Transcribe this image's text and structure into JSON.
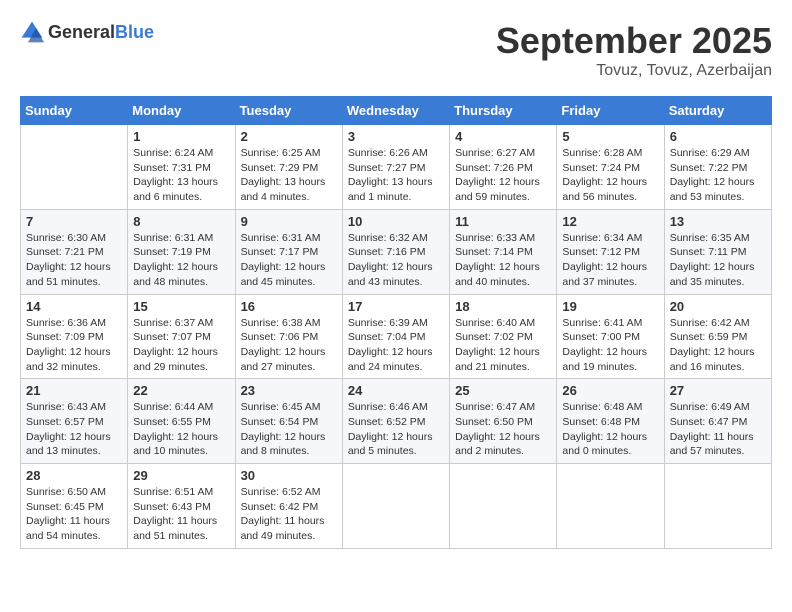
{
  "header": {
    "logo_general": "General",
    "logo_blue": "Blue",
    "title": "September 2025",
    "subtitle": "Tovuz, Tovuz, Azerbaijan"
  },
  "days_of_week": [
    "Sunday",
    "Monday",
    "Tuesday",
    "Wednesday",
    "Thursday",
    "Friday",
    "Saturday"
  ],
  "weeks": [
    [
      {
        "day": "",
        "detail": ""
      },
      {
        "day": "1",
        "detail": "Sunrise: 6:24 AM\nSunset: 7:31 PM\nDaylight: 13 hours\nand 6 minutes."
      },
      {
        "day": "2",
        "detail": "Sunrise: 6:25 AM\nSunset: 7:29 PM\nDaylight: 13 hours\nand 4 minutes."
      },
      {
        "day": "3",
        "detail": "Sunrise: 6:26 AM\nSunset: 7:27 PM\nDaylight: 13 hours\nand 1 minute."
      },
      {
        "day": "4",
        "detail": "Sunrise: 6:27 AM\nSunset: 7:26 PM\nDaylight: 12 hours\nand 59 minutes."
      },
      {
        "day": "5",
        "detail": "Sunrise: 6:28 AM\nSunset: 7:24 PM\nDaylight: 12 hours\nand 56 minutes."
      },
      {
        "day": "6",
        "detail": "Sunrise: 6:29 AM\nSunset: 7:22 PM\nDaylight: 12 hours\nand 53 minutes."
      }
    ],
    [
      {
        "day": "7",
        "detail": "Sunrise: 6:30 AM\nSunset: 7:21 PM\nDaylight: 12 hours\nand 51 minutes."
      },
      {
        "day": "8",
        "detail": "Sunrise: 6:31 AM\nSunset: 7:19 PM\nDaylight: 12 hours\nand 48 minutes."
      },
      {
        "day": "9",
        "detail": "Sunrise: 6:31 AM\nSunset: 7:17 PM\nDaylight: 12 hours\nand 45 minutes."
      },
      {
        "day": "10",
        "detail": "Sunrise: 6:32 AM\nSunset: 7:16 PM\nDaylight: 12 hours\nand 43 minutes."
      },
      {
        "day": "11",
        "detail": "Sunrise: 6:33 AM\nSunset: 7:14 PM\nDaylight: 12 hours\nand 40 minutes."
      },
      {
        "day": "12",
        "detail": "Sunrise: 6:34 AM\nSunset: 7:12 PM\nDaylight: 12 hours\nand 37 minutes."
      },
      {
        "day": "13",
        "detail": "Sunrise: 6:35 AM\nSunset: 7:11 PM\nDaylight: 12 hours\nand 35 minutes."
      }
    ],
    [
      {
        "day": "14",
        "detail": "Sunrise: 6:36 AM\nSunset: 7:09 PM\nDaylight: 12 hours\nand 32 minutes."
      },
      {
        "day": "15",
        "detail": "Sunrise: 6:37 AM\nSunset: 7:07 PM\nDaylight: 12 hours\nand 29 minutes."
      },
      {
        "day": "16",
        "detail": "Sunrise: 6:38 AM\nSunset: 7:06 PM\nDaylight: 12 hours\nand 27 minutes."
      },
      {
        "day": "17",
        "detail": "Sunrise: 6:39 AM\nSunset: 7:04 PM\nDaylight: 12 hours\nand 24 minutes."
      },
      {
        "day": "18",
        "detail": "Sunrise: 6:40 AM\nSunset: 7:02 PM\nDaylight: 12 hours\nand 21 minutes."
      },
      {
        "day": "19",
        "detail": "Sunrise: 6:41 AM\nSunset: 7:00 PM\nDaylight: 12 hours\nand 19 minutes."
      },
      {
        "day": "20",
        "detail": "Sunrise: 6:42 AM\nSunset: 6:59 PM\nDaylight: 12 hours\nand 16 minutes."
      }
    ],
    [
      {
        "day": "21",
        "detail": "Sunrise: 6:43 AM\nSunset: 6:57 PM\nDaylight: 12 hours\nand 13 minutes."
      },
      {
        "day": "22",
        "detail": "Sunrise: 6:44 AM\nSunset: 6:55 PM\nDaylight: 12 hours\nand 10 minutes."
      },
      {
        "day": "23",
        "detail": "Sunrise: 6:45 AM\nSunset: 6:54 PM\nDaylight: 12 hours\nand 8 minutes."
      },
      {
        "day": "24",
        "detail": "Sunrise: 6:46 AM\nSunset: 6:52 PM\nDaylight: 12 hours\nand 5 minutes."
      },
      {
        "day": "25",
        "detail": "Sunrise: 6:47 AM\nSunset: 6:50 PM\nDaylight: 12 hours\nand 2 minutes."
      },
      {
        "day": "26",
        "detail": "Sunrise: 6:48 AM\nSunset: 6:48 PM\nDaylight: 12 hours\nand 0 minutes."
      },
      {
        "day": "27",
        "detail": "Sunrise: 6:49 AM\nSunset: 6:47 PM\nDaylight: 11 hours\nand 57 minutes."
      }
    ],
    [
      {
        "day": "28",
        "detail": "Sunrise: 6:50 AM\nSunset: 6:45 PM\nDaylight: 11 hours\nand 54 minutes."
      },
      {
        "day": "29",
        "detail": "Sunrise: 6:51 AM\nSunset: 6:43 PM\nDaylight: 11 hours\nand 51 minutes."
      },
      {
        "day": "30",
        "detail": "Sunrise: 6:52 AM\nSunset: 6:42 PM\nDaylight: 11 hours\nand 49 minutes."
      },
      {
        "day": "",
        "detail": ""
      },
      {
        "day": "",
        "detail": ""
      },
      {
        "day": "",
        "detail": ""
      },
      {
        "day": "",
        "detail": ""
      }
    ]
  ]
}
